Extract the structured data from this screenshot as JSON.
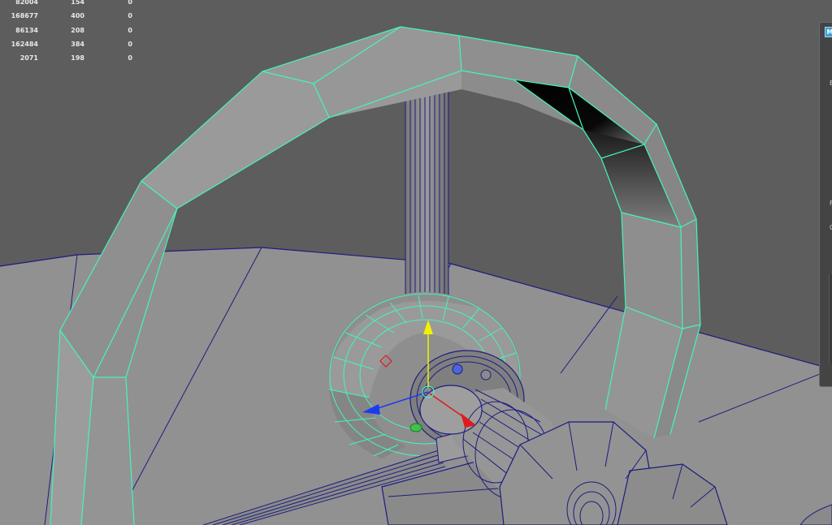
{
  "app": {
    "name": "3D modeling viewport"
  },
  "hud": {
    "rows": [
      {
        "verts": "82004",
        "edges": "154",
        "faces": "0"
      },
      {
        "verts": "168677",
        "edges": "400",
        "faces": "0"
      },
      {
        "verts": "86134",
        "edges": "208",
        "faces": "0"
      },
      {
        "verts": "162484",
        "edges": "384",
        "faces": "0"
      },
      {
        "verts": "2071",
        "edges": "198",
        "faces": "0"
      }
    ]
  },
  "side_panel": {
    "icon": "M",
    "glyphs": [
      "E",
      "F",
      "G"
    ]
  },
  "colors": {
    "background": "#5d5d5d",
    "floor": "#919191",
    "mesh_face": "#8e8e8e",
    "selection_wire": "#43f5c0",
    "mesh_wire": "#1c1c80",
    "axis_x": "#e01a1a",
    "axis_y": "#f2f200",
    "axis_z": "#1a3cf0"
  },
  "icons": {
    "move_manipulator": "move-manipulator-icon",
    "panel_app": "app-icon"
  }
}
